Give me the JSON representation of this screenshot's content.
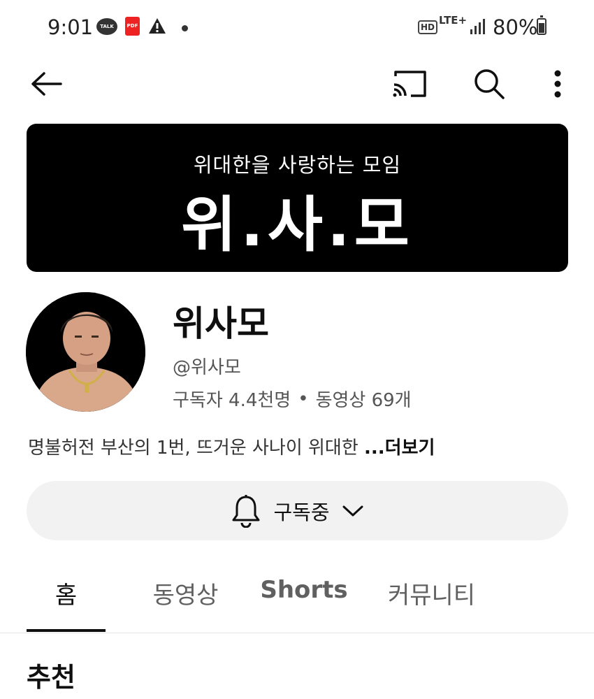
{
  "status_bar": {
    "time": "9:01",
    "talk_label": "TALK",
    "pdf_label": "PDF",
    "hd_label": "HD",
    "network": "LTE+",
    "battery": "80%"
  },
  "top_bar": {
    "icons": [
      "back-arrow-icon",
      "cast-icon",
      "search-icon",
      "more-vert-icon"
    ]
  },
  "banner": {
    "subtitle": "위대한을 사랑하는 모임",
    "title": "위.사.모"
  },
  "channel": {
    "name": "위사모",
    "handle": "@위사모",
    "subscribers": "구독자 4.4천명",
    "separator": "•",
    "videos": "동영상 69개",
    "description": "명불허전 부산의 1번, 뜨거운 사나이 위대한 ",
    "more_label": "...더보기"
  },
  "subscribe": {
    "label": "구독중",
    "icons": [
      "bell-icon",
      "chevron-down-icon"
    ]
  },
  "tabs": [
    {
      "label": "홈",
      "active": true
    },
    {
      "label": "동영상",
      "active": false
    },
    {
      "label": "Shorts",
      "active": false
    },
    {
      "label": "커뮤니티",
      "active": false
    }
  ],
  "section": {
    "title": "추천"
  },
  "colors": {
    "banner_bg": "#000000",
    "subscribe_bg": "#f2f2f2",
    "text_primary": "#0f0f0f",
    "text_secondary": "#606060"
  }
}
